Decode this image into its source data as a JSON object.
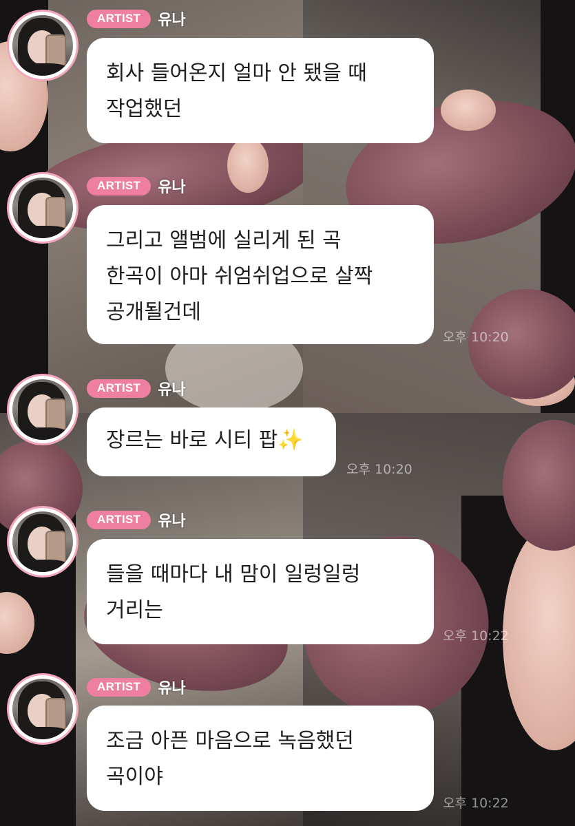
{
  "messages": [
    {
      "badge": "ARTIST",
      "name": "유나",
      "lines": [
        "회사 들어온지 얼마 안 됐을 때",
        "작업했던"
      ],
      "time": ""
    },
    {
      "badge": "ARTIST",
      "name": "유나",
      "lines": [
        "그리고 앨범에 실리게 된 곡",
        "한곡이 아마 쉬엄쉬업으로 살짝",
        "공개될건데"
      ],
      "time": "오후 10:20"
    },
    {
      "badge": "ARTIST",
      "name": "유나",
      "lines": [
        "장르는 바로 시티 팝"
      ],
      "emoji": "✨",
      "time": "오후 10:20"
    },
    {
      "badge": "ARTIST",
      "name": "유나",
      "lines": [
        "들을 때마다 내 맘이 일렁일렁",
        "거리는"
      ],
      "time": "오후 10:22"
    },
    {
      "badge": "ARTIST",
      "name": "유나",
      "lines": [
        "조금 아픈 마음으로 녹음했던",
        "곡이야"
      ],
      "time": "오후 10:22"
    }
  ],
  "colors": {
    "badge": "#ee7fa0",
    "avatar_ring": "#f3a7bd",
    "bubble": "#ffffff",
    "text": "#1e1e1e"
  }
}
